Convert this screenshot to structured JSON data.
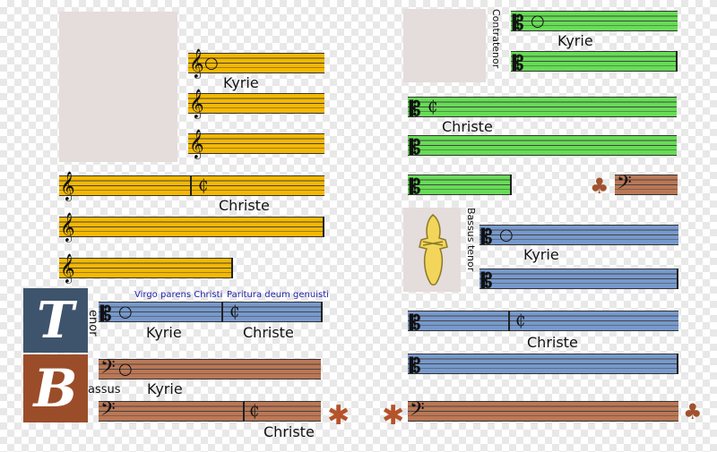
{
  "colors": {
    "superius": "#f5b800",
    "contratenor": "#66dd55",
    "bassus_tenor": "#7799cc",
    "tenor_box": "#3e546d",
    "bassus": "#bb7755",
    "bassus_box": "#9b4d2a",
    "placeholder": "#e5dcdc",
    "ornament": "#b5532a",
    "figure": "#f2d55a"
  },
  "labels": {
    "kyrie": "Kyrie",
    "christe": "Christe",
    "contratenor": "Contratenor",
    "bassus_tenor": "Bassus tenor",
    "tenor_rest": "enor",
    "bassus_rest": "assus",
    "tenor_initial": "T",
    "bassus_initial": "B",
    "virgo": "Virgo parens Christi",
    "paritura": "Paritura deum genuisti"
  },
  "symbols": {
    "g_clef": "𝄞",
    "c_clef": "𝄡",
    "f_clef": "𝄢",
    "circle": "○",
    "cut_c": "₵",
    "ornament": "✱",
    "club": "♣"
  }
}
